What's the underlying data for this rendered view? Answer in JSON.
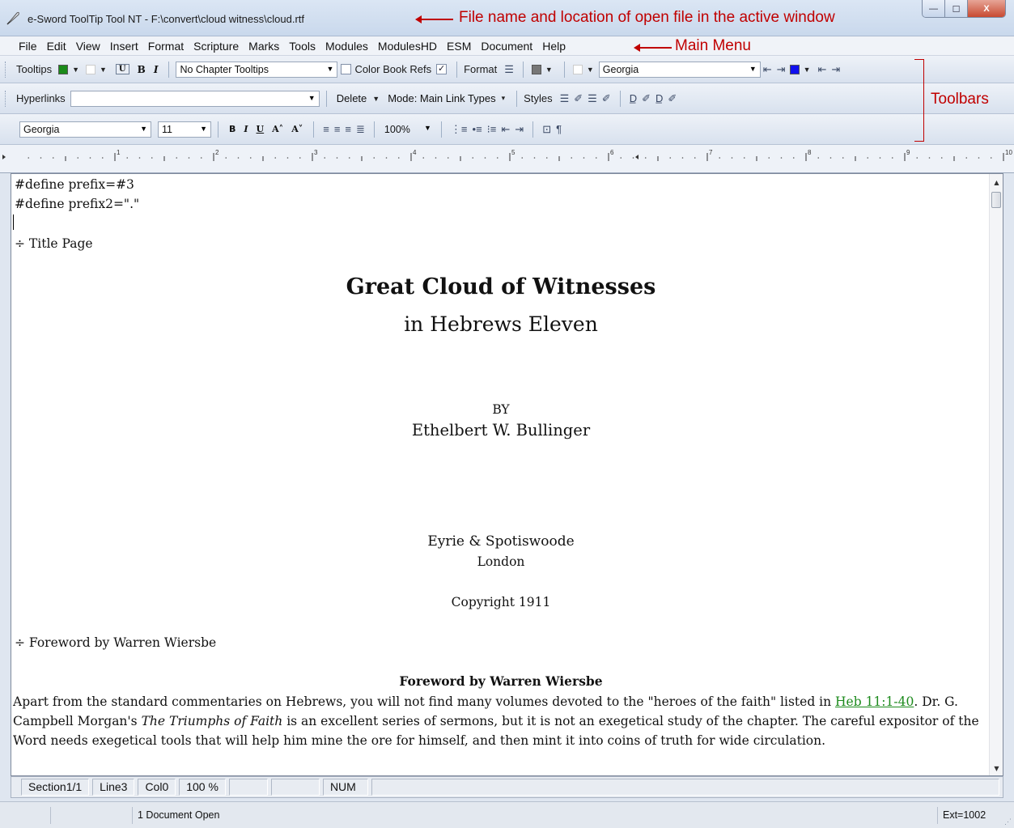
{
  "window": {
    "title": "e-Sword ToolTip Tool NT - F:\\convert\\cloud witness\\cloud.rtf",
    "min_glyph": "—",
    "max_glyph": "☐",
    "close_glyph": "X"
  },
  "annotations": {
    "file_name": "File name and location of open file in the active window",
    "main_menu": "Main Menu",
    "toolbars": "Toolbars"
  },
  "menu": [
    "File",
    "Edit",
    "View",
    "Insert",
    "Format",
    "Scripture",
    "Marks",
    "Tools",
    "Modules",
    "ModulesHD",
    "ESM",
    "Document",
    "Help"
  ],
  "toolbar1": {
    "tooltips_label": "Tooltips",
    "tooltip_color": "#1a8a1a",
    "chapter_select": "No Chapter Tooltips",
    "color_book_refs_label": "Color Book Refs",
    "color_book_refs_checked": true,
    "format_label": "Format",
    "font_select": "Georgia",
    "highlight_color": "#1010ee"
  },
  "toolbar2": {
    "hyperlinks_label": "Hyperlinks",
    "hyperlinks_value": "",
    "delete_label": "Delete",
    "mode_label": "Mode: Main Link Types",
    "styles_label": "Styles"
  },
  "toolbar3": {
    "font_select": "Georgia",
    "size_select": "11",
    "zoom_select": "100%"
  },
  "document": {
    "lines": [
      "#define prefix=#3",
      "#define prefix2=\".\""
    ],
    "title_page_marker": "÷ Title Page",
    "title": "Great Cloud of Witnesses",
    "subtitle": "in Hebrews Eleven",
    "by": "BY",
    "author": "Ethelbert W. Bullinger",
    "publisher": "Eyrie & Spotiswoode",
    "city": "London",
    "copyright": "Copyright 1911",
    "foreword_marker": "÷ Foreword by Warren Wiersbe",
    "foreword_heading": "Foreword by Warren Wiersbe",
    "para_part1": "Apart from the standard commentaries on Hebrews, you will not find many volumes devoted to the \"heroes of the faith\" listed in ",
    "para_link": "Heb  11:1-40",
    "para_part2": ". Dr. G. Campbell Morgan's ",
    "para_italic": "The Triumphs of Faith",
    "para_part3": " is an excellent series of sermons, but it is not an exegetical study of the chapter. The careful expositor of the Word needs exegetical tools that will help him mine the ore for himself, and then mint it into coins of truth for wide circulation."
  },
  "status": {
    "section": "Section1/1",
    "line": "Line3",
    "col": "Col0",
    "zoom": "100 %",
    "num": "NUM",
    "docs_open": "1 Document Open",
    "ext": "Ext=1002"
  }
}
